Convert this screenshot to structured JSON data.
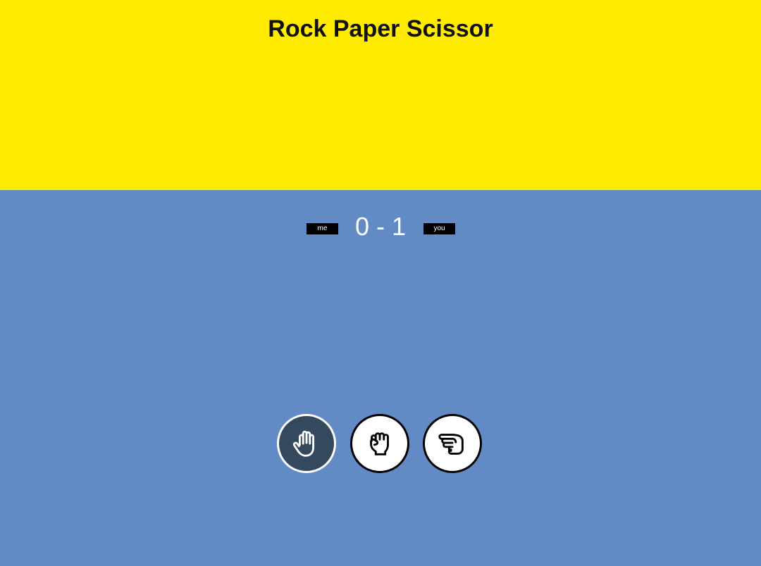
{
  "header": {
    "title": "Rock Paper Scissor"
  },
  "score": {
    "player_left_label": "me",
    "player_right_label": "you",
    "text": "0 - 1"
  },
  "choices": [
    {
      "name": "paper",
      "icon": "hand-paper-icon",
      "selected": true
    },
    {
      "name": "rock",
      "icon": "hand-rock-icon",
      "selected": false
    },
    {
      "name": "scissor",
      "icon": "hand-scissors-icon",
      "selected": false
    }
  ],
  "colors": {
    "header_bg": "#ffeb00",
    "board_bg": "#628bc6",
    "selected_bg": "#34495e",
    "tag_bg": "#000000"
  }
}
